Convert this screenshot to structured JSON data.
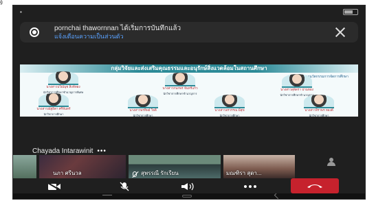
{
  "topcorner": "ğ",
  "notification": {
    "line1": "pornchai thawornnan ได้เริ่มการบันทึกแล้ว",
    "line2": "แจ้งเตือนความเป็นส่วนตัว"
  },
  "presentation": {
    "banner": "กลุ่มวิจัยและส่งเสริมคุณธรรมและอนุรักษ์สิ่งแวดล้อมในสถานศึกษา",
    "subtitle": "สำนักพัฒนานวัตกรรมการจัดการศึกษา",
    "people_row1": [
      {
        "name": "นางสาวปวีณ์นุช สิงห์ทอง",
        "role": "นักวิชาการศึกษาชำนาญการพิเศษ"
      },
      {
        "name": "นางสาวกนกพร จันทร์แก้ว",
        "role": "นักวิชาการศึกษาชำนาญการ"
      },
      {
        "name": "นางสาวสุพัตรา ปานทอง",
        "role": "นักวิชาการศึกษาชำนาญการ"
      }
    ],
    "people_row2": [
      {
        "name": "นางสาวณัฐธิดา ศรีจันทร์",
        "role": "นักวิชาการศึกษา"
      },
      {
        "name": "นางสาวพรทิพย์ ใจดี",
        "role": "นักวิชาการศึกษา"
      },
      {
        "name": "นางสาวอรวรรณ มีสุข",
        "role": "นักวิชาการศึกษา"
      },
      {
        "name": "นางสาวจิราพร ทองดี",
        "role": "นักวิชาการศึกษา"
      }
    ]
  },
  "speaker": {
    "name": "Chayada Intarawinit",
    "more": "•••"
  },
  "thumbnails": [
    {
      "name": ""
    },
    {
      "name": "นภา ศรีนวล"
    },
    {
      "name": "สุพรรณี รักเรียน"
    },
    {
      "name": "มณฑิรา สุดา..."
    },
    {
      "name": ""
    }
  ]
}
